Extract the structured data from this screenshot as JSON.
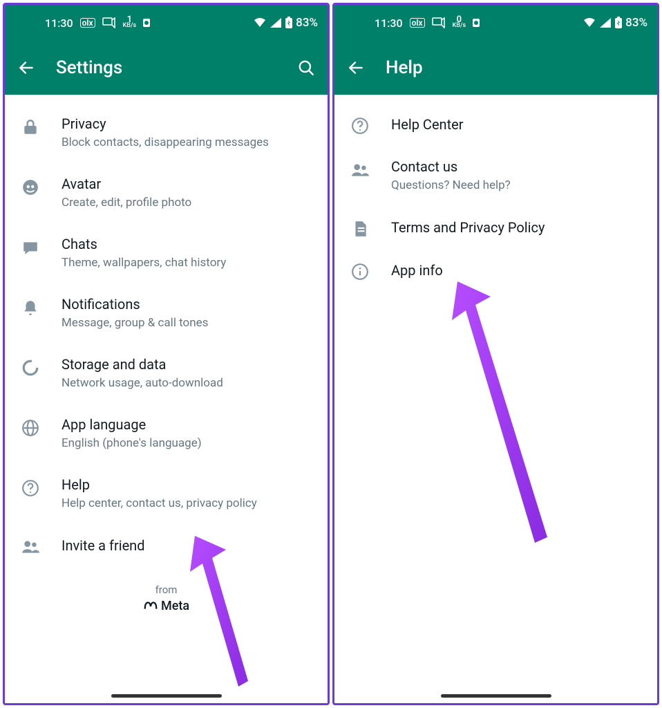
{
  "status": {
    "time": "11:30",
    "olx": "olx",
    "kb_top": "1",
    "kb_unit": "KB/s",
    "battery": "83%"
  },
  "status2": {
    "time": "11:30",
    "olx": "olx",
    "kb_top": "0",
    "kb_unit": "KB/s",
    "battery": "83%"
  },
  "left": {
    "title": "Settings",
    "items": [
      {
        "icon": "lock",
        "title": "Privacy",
        "sub": "Block contacts, disappearing messages"
      },
      {
        "icon": "avatar",
        "title": "Avatar",
        "sub": "Create, edit, profile photo"
      },
      {
        "icon": "chats",
        "title": "Chats",
        "sub": "Theme, wallpapers, chat history"
      },
      {
        "icon": "bell",
        "title": "Notifications",
        "sub": "Message, group & call tones"
      },
      {
        "icon": "data",
        "title": "Storage and data",
        "sub": "Network usage, auto-download"
      },
      {
        "icon": "globe",
        "title": "App language",
        "sub": "English (phone's language)"
      },
      {
        "icon": "help",
        "title": "Help",
        "sub": "Help center, contact us, privacy policy"
      },
      {
        "icon": "people",
        "title": "Invite a friend",
        "sub": ""
      }
    ],
    "footer_from": "from",
    "footer_meta": "Meta"
  },
  "right": {
    "title": "Help",
    "items": [
      {
        "icon": "help",
        "title": "Help Center",
        "sub": ""
      },
      {
        "icon": "people",
        "title": "Contact us",
        "sub": "Questions? Need help?"
      },
      {
        "icon": "doc",
        "title": "Terms and Privacy Policy",
        "sub": ""
      },
      {
        "icon": "info",
        "title": "App info",
        "sub": ""
      }
    ]
  }
}
